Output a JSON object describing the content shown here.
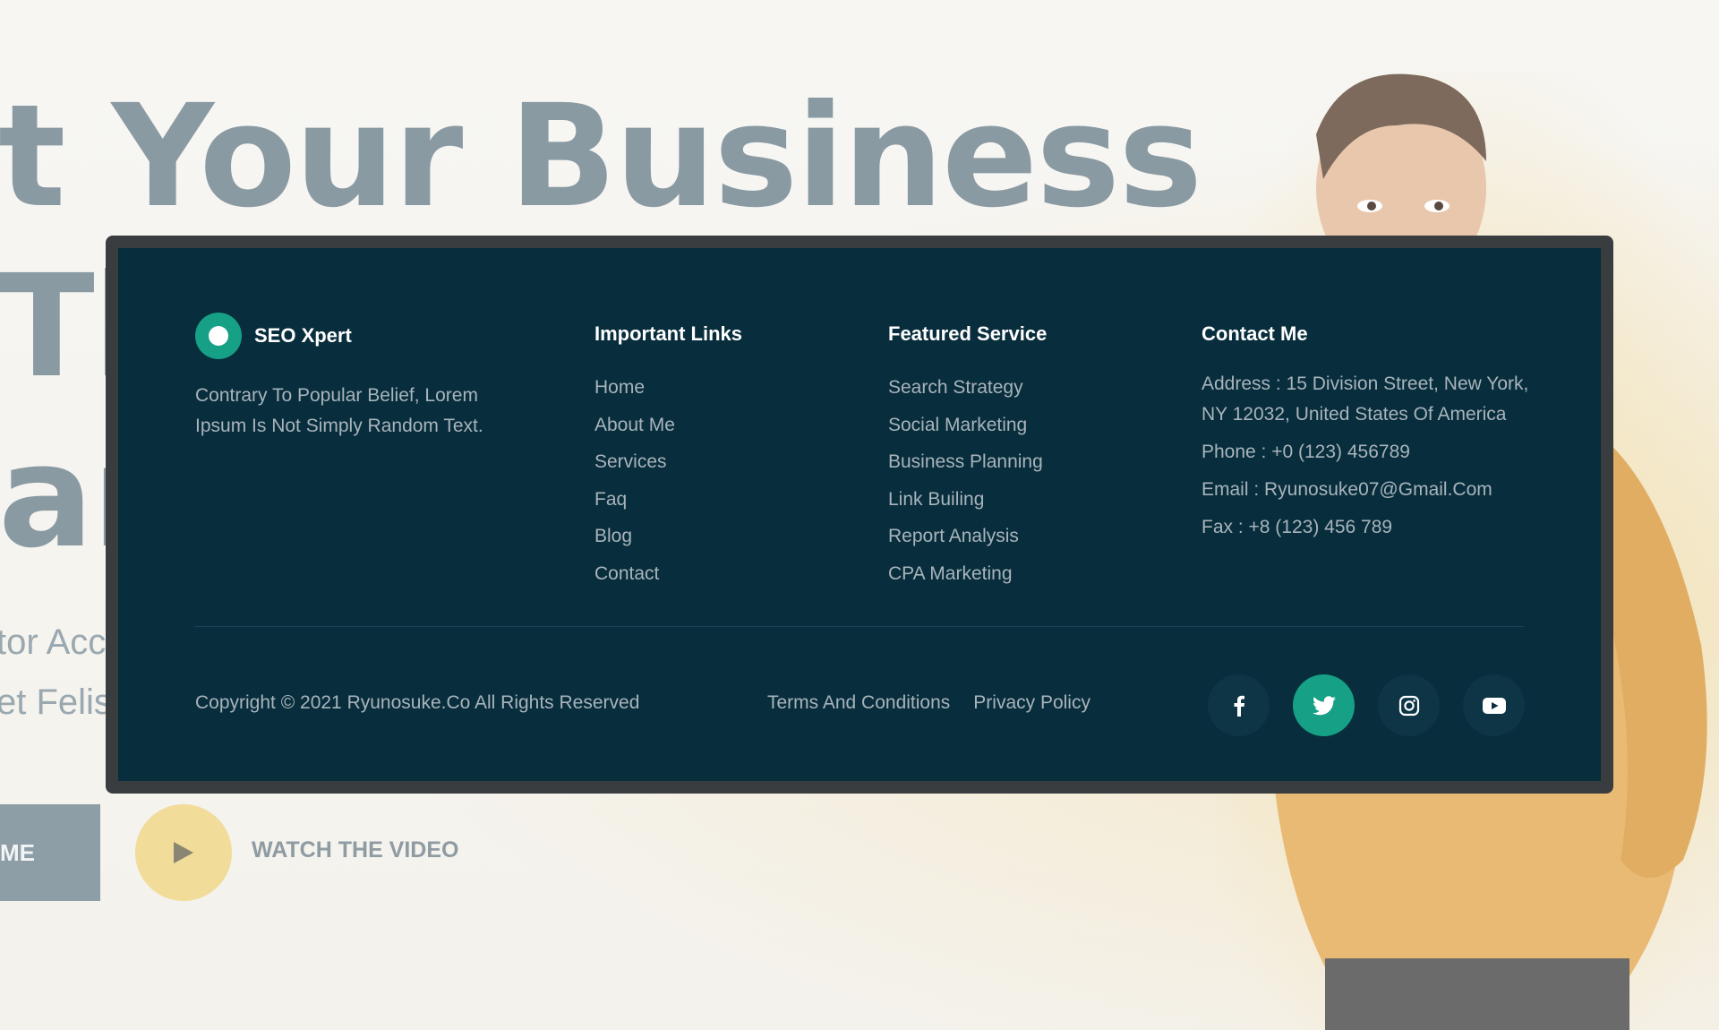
{
  "hero": {
    "line1": "t Your Business",
    "line2": "Tl",
    "line3": "ar",
    "sub1": "tor Accu",
    "sub2": "et Felis",
    "cta_label": "ME",
    "watch_label": "WATCH THE VIDEO"
  },
  "footer": {
    "brand": {
      "name": "SEO Xpert"
    },
    "about": "Contrary To Popular Belief, Lorem Ipsum Is Not Simply Random Text.",
    "links": {
      "title": "Important Links",
      "items": [
        "Home",
        "About Me",
        "Services",
        "Faq",
        "Blog",
        "Contact"
      ]
    },
    "services": {
      "title": "Featured Service",
      "items": [
        "Search Strategy",
        "Social Marketing",
        "Business Planning",
        "Link Builing",
        "Report Analysis",
        "CPA Marketing"
      ]
    },
    "contact": {
      "title": "Contact Me",
      "address": "Address : 15 Division Street, New York, NY 12032, United States Of America",
      "phone": "Phone : +0 (123) 456789",
      "email": "Email : Ryunosuke07@Gmail.Com",
      "fax": "Fax : +8 (123) 456 789"
    },
    "copyright": "Copyright © 2021 Ryunosuke.Co All Rights Reserved",
    "legal": [
      "Terms And Conditions",
      "Privacy Policy"
    ],
    "socials": [
      {
        "icon": "facebook-icon",
        "active": false
      },
      {
        "icon": "twitter-icon",
        "active": true
      },
      {
        "icon": "instagram-icon",
        "active": false
      },
      {
        "icon": "youtube-icon",
        "active": false
      }
    ]
  },
  "colors": {
    "footer_bg": "#082d3d",
    "accent": "#16a085",
    "hero_text": "#8a9aa3",
    "play_button": "#f1dc9a"
  }
}
